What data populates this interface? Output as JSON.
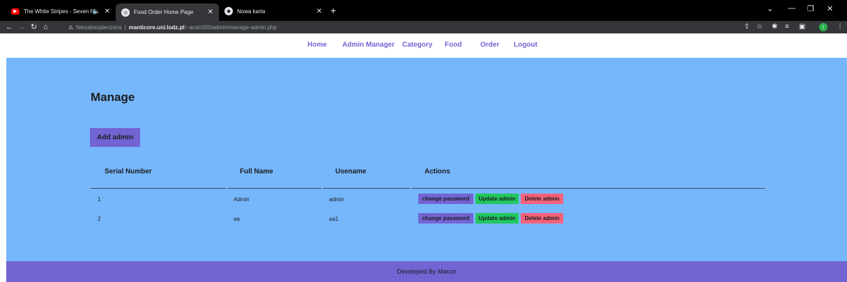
{
  "browser": {
    "tabs": [
      {
        "title": "The White Stripes - Seven N",
        "active": false
      },
      {
        "title": "Food Order Home Page",
        "active": true
      },
      {
        "title": "Nowa karta",
        "active": false
      }
    ],
    "new_tab": "+",
    "address": {
      "security_label": "Niezabezpieczona",
      "host": "manticore.uni.lodz.pl",
      "path": "/~acdc000/admin/manage-admin.php"
    },
    "profile_initial": "I"
  },
  "nav": {
    "links": [
      "Home",
      "Admin Manager",
      "Category",
      "Food",
      "Order",
      "Logout"
    ]
  },
  "page": {
    "heading": "Manage",
    "add_button": "Add admin",
    "table": {
      "headers": [
        "Serial Number",
        "Full Name",
        "Usename",
        "Actions"
      ],
      "rows": [
        {
          "serial": "1",
          "full_name": "Admin",
          "username": "admin"
        },
        {
          "serial": "2",
          "full_name": "aa",
          "username": "aa1"
        }
      ],
      "actions": {
        "change_password": "change password",
        "update": "Update admin",
        "delete": "Delete admin"
      }
    }
  },
  "footer": {
    "text": "Developed By Marcin"
  },
  "colors": {
    "accent": "#7364d4",
    "content_bg": "#76b7fc",
    "update": "#22c75f",
    "delete": "#f5617a"
  }
}
